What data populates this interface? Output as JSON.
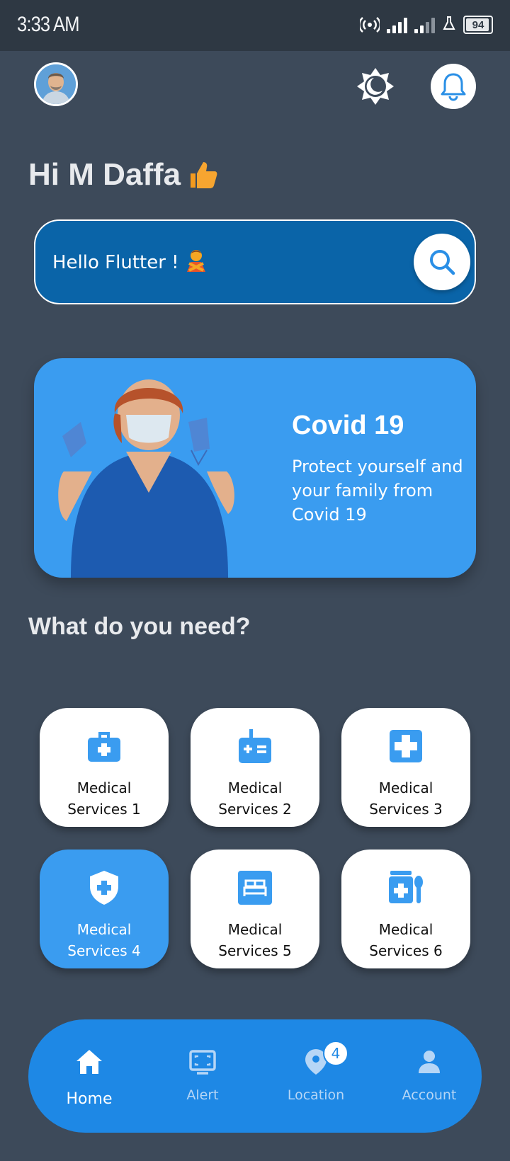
{
  "status_bar": {
    "time": "3:33 AM",
    "battery": "94",
    "battery_level": 0.94
  },
  "header": {
    "avatar_icon": "user-avatar",
    "theme_icon": "brightness-moon-icon",
    "notification_icon": "bell-icon"
  },
  "greeting": {
    "text": "Hi M Daffa",
    "emoji_icon": "thumbs-up-emoji"
  },
  "search": {
    "text": "Hello Flutter !",
    "emoji_icon": "person-gesturing-no-emoji",
    "button_icon": "search-icon"
  },
  "banner": {
    "title": "Covid 19",
    "subtitle": "Protect yourself and your family from Covid 19",
    "image_icon": "nurse-with-mask"
  },
  "section": {
    "title": "What do you need?"
  },
  "services": [
    {
      "label": "Medical Services 1",
      "icon": "medical-kit-icon",
      "active": false
    },
    {
      "label": "Medical Services 2",
      "icon": "medical-calculator-icon",
      "active": false
    },
    {
      "label": "Medical Services 3",
      "icon": "medical-plus-icon",
      "active": false
    },
    {
      "label": "Medical Services 4",
      "icon": "medical-shield-icon",
      "active": true
    },
    {
      "label": "Medical Services 5",
      "icon": "bed-icon",
      "active": false
    },
    {
      "label": "Medical Services 6",
      "icon": "medicine-spoon-icon",
      "active": false
    }
  ],
  "nav": [
    {
      "label": "Home",
      "icon": "home-icon",
      "active": true
    },
    {
      "label": "Alert",
      "icon": "monitor-icon",
      "active": false
    },
    {
      "label": "Location",
      "icon": "location-pin-icon",
      "active": false,
      "badge": "4"
    },
    {
      "label": "Account",
      "icon": "person-icon",
      "active": false
    }
  ],
  "colors": {
    "background": "#3d4a5a",
    "accent": "#3a9cf0",
    "nav": "#1e88e5",
    "search": "#0a64a8"
  }
}
